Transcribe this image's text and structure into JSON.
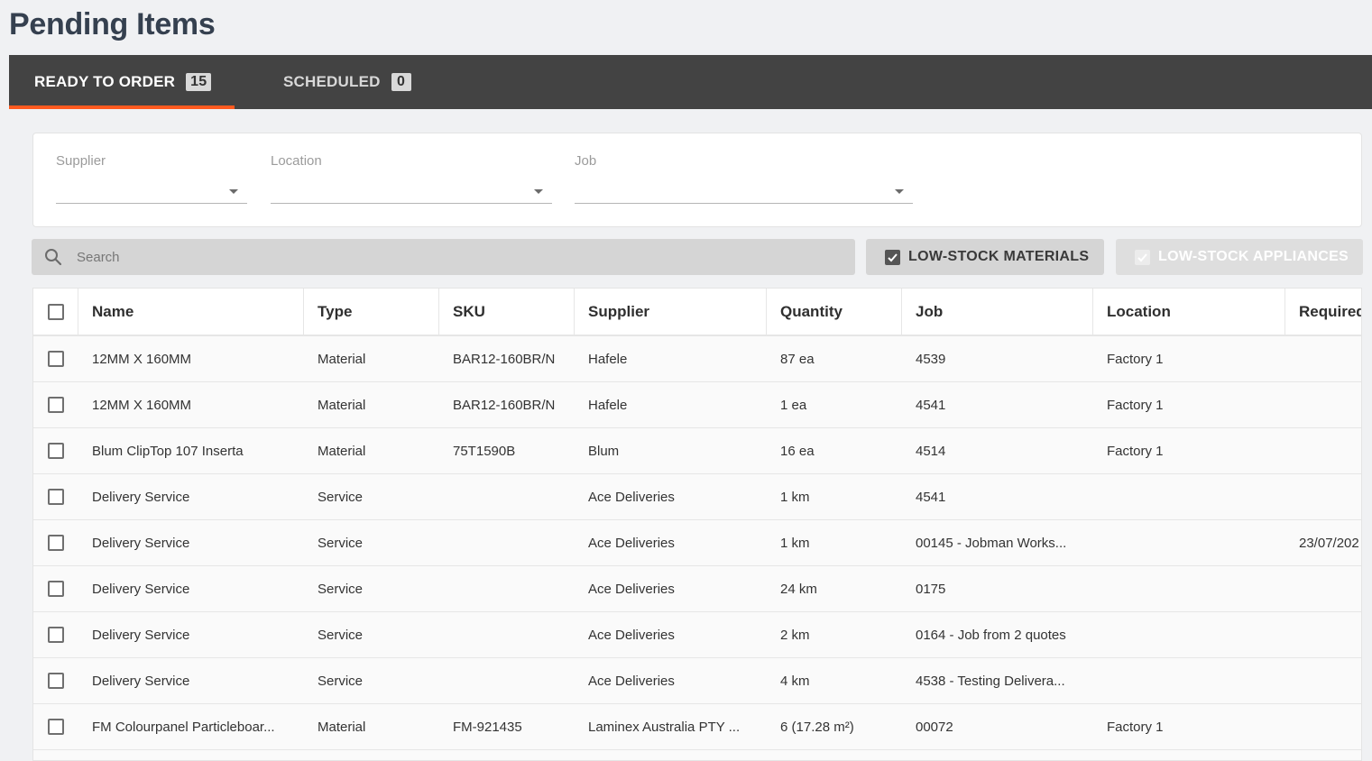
{
  "page": {
    "title": "Pending Items"
  },
  "tabs": [
    {
      "label": "READY TO ORDER",
      "count": "15"
    },
    {
      "label": "SCHEDULED",
      "count": "0"
    }
  ],
  "filters": {
    "supplier_label": "Supplier",
    "location_label": "Location",
    "job_label": "Job"
  },
  "search": {
    "placeholder": "Search"
  },
  "toggles": {
    "materials_label": "LOW-STOCK MATERIALS",
    "appliances_label": "LOW-STOCK APPLIANCES"
  },
  "table": {
    "headers": {
      "name": "Name",
      "type": "Type",
      "sku": "SKU",
      "supplier": "Supplier",
      "quantity": "Quantity",
      "job": "Job",
      "location": "Location",
      "required": "Required"
    },
    "rows": [
      {
        "name": "12MM X 160MM",
        "type": "Material",
        "sku": "BAR12-160BR/N",
        "supplier": "Hafele",
        "quantity": "87 ea",
        "job": "4539",
        "location": "Factory 1",
        "required": ""
      },
      {
        "name": "12MM X 160MM",
        "type": "Material",
        "sku": "BAR12-160BR/N",
        "supplier": "Hafele",
        "quantity": "1 ea",
        "job": "4541",
        "location": "Factory 1",
        "required": ""
      },
      {
        "name": "Blum ClipTop 107 Inserta",
        "type": "Material",
        "sku": "75T1590B",
        "supplier": "Blum",
        "quantity": "16 ea",
        "job": "4514",
        "location": "Factory 1",
        "required": ""
      },
      {
        "name": "Delivery Service",
        "type": "Service",
        "sku": "",
        "supplier": "Ace Deliveries",
        "quantity": "1 km",
        "job": "4541",
        "location": "",
        "required": ""
      },
      {
        "name": "Delivery Service",
        "type": "Service",
        "sku": "",
        "supplier": "Ace Deliveries",
        "quantity": "1 km",
        "job": "00145 - Jobman Works...",
        "location": "",
        "required": "23/07/202"
      },
      {
        "name": "Delivery Service",
        "type": "Service",
        "sku": "",
        "supplier": "Ace Deliveries",
        "quantity": "24 km",
        "job": "0175",
        "location": "",
        "required": ""
      },
      {
        "name": "Delivery Service",
        "type": "Service",
        "sku": "",
        "supplier": "Ace Deliveries",
        "quantity": "2 km",
        "job": "0164 - Job from 2 quotes",
        "location": "",
        "required": ""
      },
      {
        "name": "Delivery Service",
        "type": "Service",
        "sku": "",
        "supplier": "Ace Deliveries",
        "quantity": "4 km",
        "job": "4538 - Testing Delivera...",
        "location": "",
        "required": ""
      },
      {
        "name": "FM Colourpanel Particleboar...",
        "type": "Material",
        "sku": "FM-921435",
        "supplier": "Laminex Australia PTY ...",
        "quantity": "6 (17.28 m²)",
        "job": "00072",
        "location": "Factory 1",
        "required": ""
      }
    ]
  },
  "colors": {
    "accent": "#ff5a1f",
    "tabbar": "#434343",
    "title": "#35404f"
  }
}
